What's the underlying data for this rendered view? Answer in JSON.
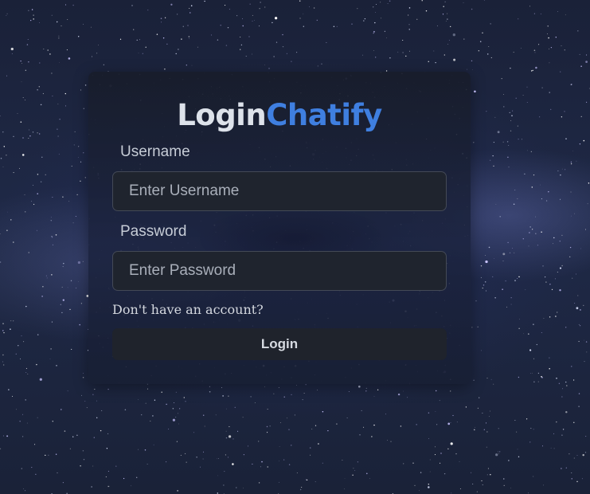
{
  "login_form": {
    "title_part1": "Login",
    "title_part2": "Chatify",
    "username_label": "Username",
    "username_placeholder": "Enter Username",
    "password_label": "Password",
    "password_placeholder": "Enter Password",
    "signup_link": "Don't have an account?",
    "login_button": "Login"
  },
  "colors": {
    "brand_accent": "#3f7fe0",
    "card_background": "#1b2030",
    "input_background": "#1f242e",
    "button_background": "#1f232c"
  }
}
